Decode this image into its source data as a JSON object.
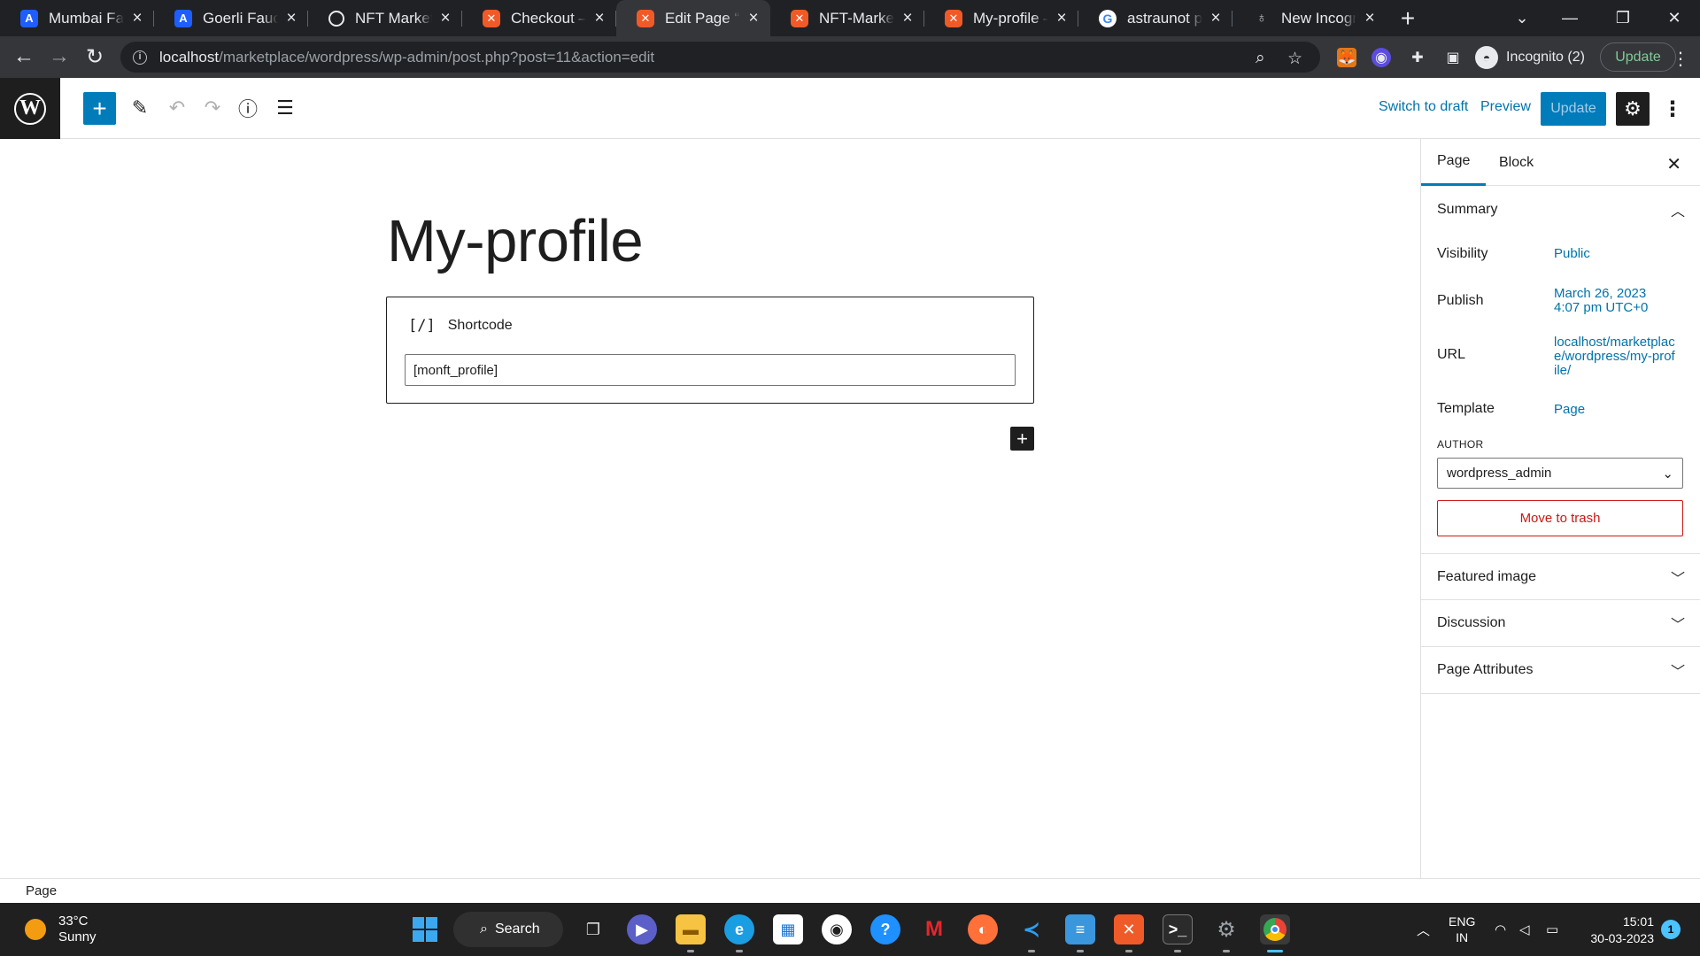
{
  "browser": {
    "tabs": [
      {
        "title": "Mumbai Faucet",
        "icon": "alchemy-icon"
      },
      {
        "title": "Goerli Faucet",
        "icon": "alchemy-icon"
      },
      {
        "title": "NFT Marketplace",
        "icon": "globe-icon"
      },
      {
        "title": "Checkout – wordpress",
        "icon": "xampp-icon"
      },
      {
        "title": "Edit Page “My-profile”",
        "icon": "xampp-icon"
      },
      {
        "title": "NFT-Marketplace",
        "icon": "xampp-icon"
      },
      {
        "title": "My-profile – wordpress",
        "icon": "xampp-icon"
      },
      {
        "title": "astraunot png",
        "icon": "google-icon"
      },
      {
        "title": "New Incognito Tab",
        "icon": "incognito-icon"
      }
    ],
    "active_tab_index": 4,
    "url_host": "localhost",
    "url_path": "/marketplace/wordpress/wp-admin/post.php?post=11&action=edit",
    "profile_label": "Incognito (2)",
    "update_label": "Update"
  },
  "editor": {
    "switch_to_draft": "Switch to draft",
    "preview": "Preview",
    "update": "Update",
    "page_title": "My-profile",
    "block": {
      "icon_text": "[/]",
      "label": "Shortcode",
      "value": "[monft_profile]"
    }
  },
  "sidebar": {
    "tabs": [
      "Page",
      "Block"
    ],
    "summary": {
      "title": "Summary",
      "rows": [
        {
          "label": "Visibility",
          "value": "Public"
        },
        {
          "label": "Publish",
          "value": "March 26, 2023 4:07 pm UTC+0"
        },
        {
          "label": "URL",
          "value": "localhost/marketplace/wordpress/my-profile/"
        },
        {
          "label": "Template",
          "value": "Page"
        }
      ],
      "author_label": "AUTHOR",
      "author_value": "wordpress_admin",
      "trash": "Move to trash"
    },
    "panels": [
      "Featured image",
      "Discussion",
      "Page Attributes"
    ]
  },
  "footer": {
    "breadcrumb": "Page"
  },
  "taskbar": {
    "temperature": "33°C",
    "condition": "Sunny",
    "search": "Search",
    "lang": "ENG",
    "region": "IN",
    "time": "15:01",
    "date": "30-03-2023",
    "notifications": "1"
  },
  "colors": {
    "wp_blue": "#007cba",
    "link_blue": "#0073aa",
    "danger_red": "#cc1818",
    "chrome_dark": "#202124"
  }
}
